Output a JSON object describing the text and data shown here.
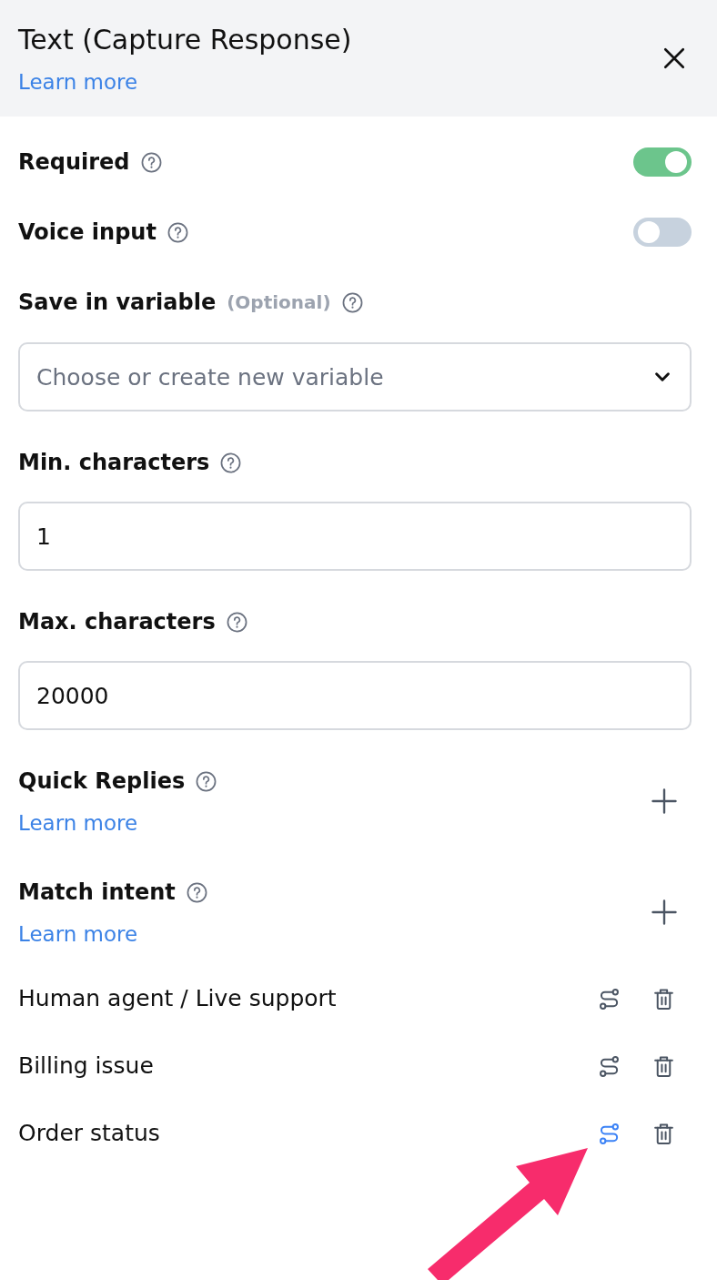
{
  "panel": {
    "title": "Text (Capture Response)",
    "link": "Learn more"
  },
  "toggles": [
    {
      "label": "Required",
      "on": true
    },
    {
      "label": "Voice input",
      "on": false
    }
  ],
  "variable": {
    "label": "Save in variable",
    "optional": "(Optional)",
    "placeholder": "Choose or create new variable"
  },
  "limits": [
    {
      "label": "Min. characters",
      "value": "1"
    },
    {
      "label": "Max. characters",
      "value": "20000"
    }
  ],
  "sections": [
    {
      "label": "Quick Replies",
      "link": "Learn more"
    },
    {
      "label": "Match intent",
      "link": "Learn more"
    }
  ],
  "intents": [
    {
      "label": "Human agent / Live support",
      "highlighted": false
    },
    {
      "label": "Billing issue",
      "highlighted": false
    },
    {
      "label": "Order status",
      "highlighted": true
    }
  ],
  "annotation": {
    "kind": "arrow"
  }
}
